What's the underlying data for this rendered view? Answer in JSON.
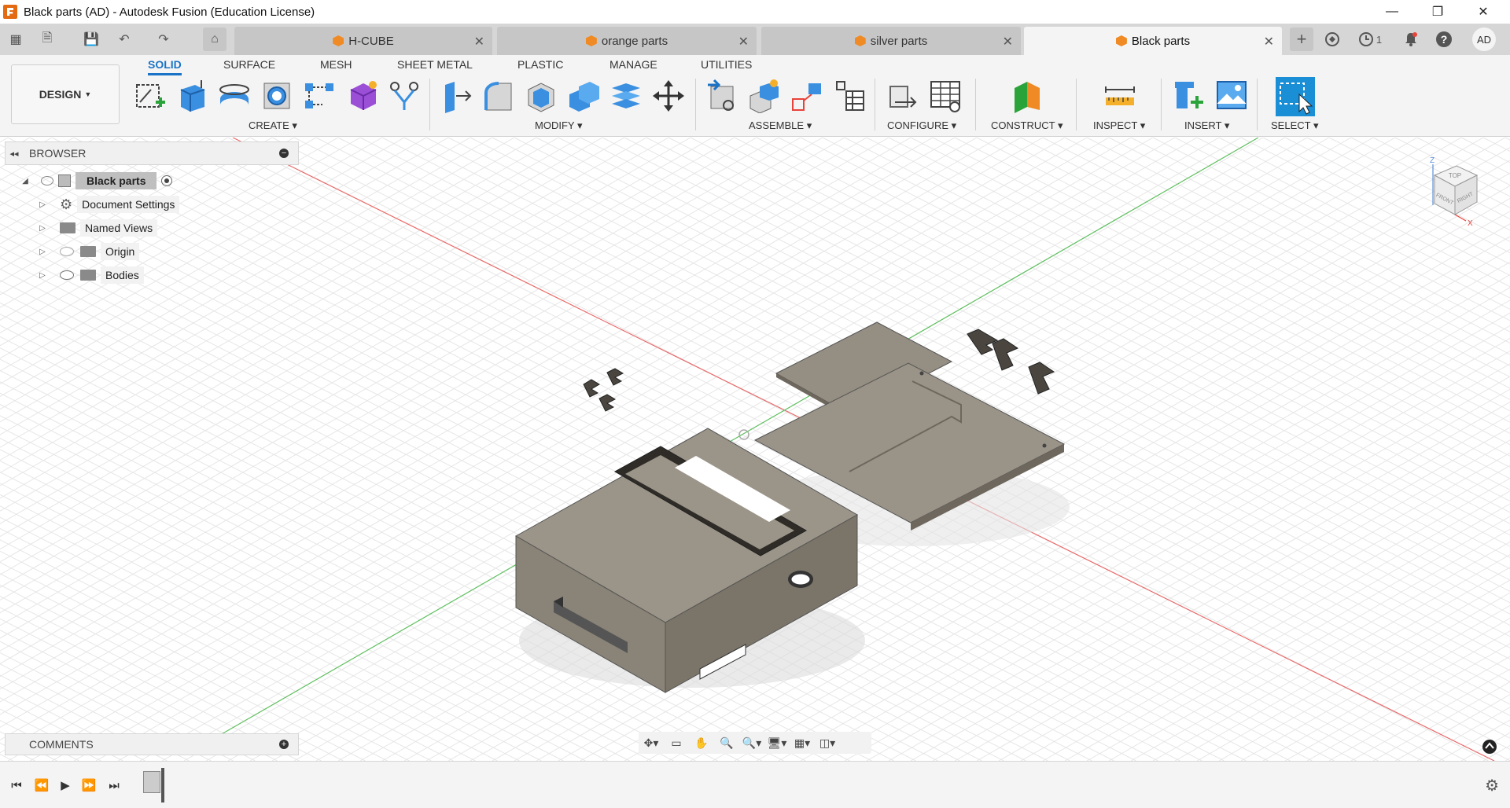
{
  "window": {
    "title": "Black parts (AD) - Autodesk Fusion (Education License)",
    "minimize": "—",
    "restore": "❐",
    "close": "✕"
  },
  "quick_access": {
    "grid_icon": "▦",
    "file_icon": "🗎",
    "save_icon": "💾",
    "undo_icon": "↶",
    "redo_icon": "↷",
    "home_icon": "⌂",
    "new_tab": "+",
    "job_count": "1",
    "user_initials": "AD"
  },
  "tabs": [
    {
      "label": "H-CUBE",
      "active": false
    },
    {
      "label": "orange parts",
      "active": false
    },
    {
      "label": "silver parts",
      "active": false
    },
    {
      "label": "Black parts",
      "active": true
    }
  ],
  "ribbon": {
    "workspace": "DESIGN",
    "tabs": [
      "SOLID",
      "SURFACE",
      "MESH",
      "SHEET METAL",
      "PLASTIC",
      "MANAGE",
      "UTILITIES"
    ],
    "active_tab": "SOLID",
    "groups": [
      "CREATE",
      "MODIFY",
      "ASSEMBLE",
      "CONFIGURE",
      "CONSTRUCT",
      "INSPECT",
      "INSERT",
      "SELECT"
    ]
  },
  "browser": {
    "title": "BROWSER",
    "root": "Black parts",
    "items": [
      "Document Settings",
      "Named Views",
      "Origin",
      "Bodies"
    ]
  },
  "comments": {
    "title": "COMMENTS"
  },
  "viewcube": {
    "top": "TOP",
    "front": "FRONT",
    "right": "RIGHT",
    "z": "Z",
    "x": "X"
  },
  "colors": {
    "accent": "#1a73c6",
    "model": "#8c857a",
    "x_axis": "#e86a6a",
    "y_axis": "#5fbf5f"
  }
}
